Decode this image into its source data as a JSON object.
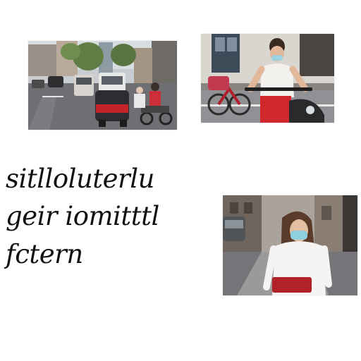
{
  "caption_lines": [
    "sitlloluterlu",
    "geir iomitttl",
    "fctern"
  ],
  "photos": [
    {
      "subject": "street traffic with cars and scooters"
    },
    {
      "subject": "man in face mask riding a bicycle"
    },
    {
      "subject": "woman in face mask walking on a city street"
    }
  ],
  "colors": {
    "background": "#ffffff",
    "text": "#111111",
    "accent_red": "#d0262c"
  }
}
